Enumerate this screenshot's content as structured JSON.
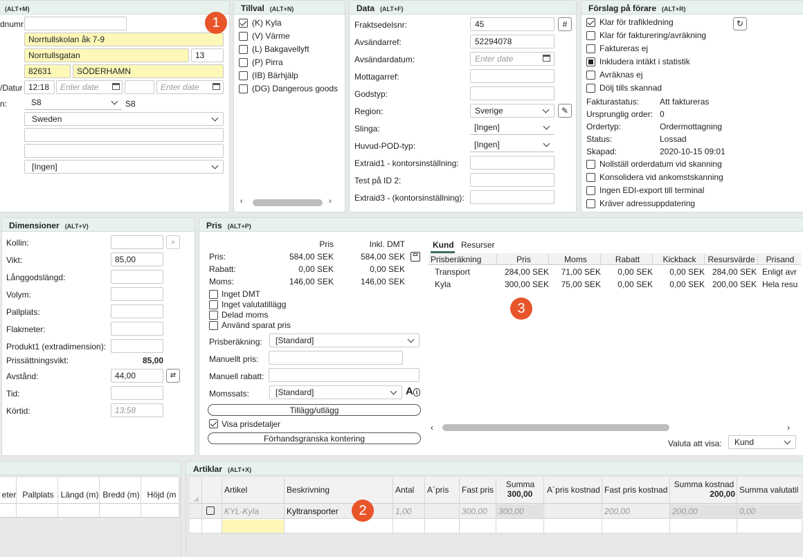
{
  "panel_a": {
    "header": "(ALT+M)",
    "labels": {
      "dnumr": "dnumr",
      "datur": "/Datur",
      "n": "n:"
    },
    "name": "Norrtullskolan åk 7-9",
    "street": "Norrtullsgatan",
    "street_no": "13",
    "zip": "82631",
    "city": "SÖDERHAMN",
    "time": "12:18",
    "date1": "Enter date",
    "date2": "Enter date",
    "code": "S8",
    "code_text": "S8",
    "country": "Sweden",
    "select_last": "[Ingen]"
  },
  "tillval": {
    "title": "Tillval",
    "shortcut": "(ALT+N)",
    "items": [
      {
        "label": "(K) Kyla",
        "checked": true
      },
      {
        "label": "(V) Värme",
        "checked": false
      },
      {
        "label": "(L) Bakgavellyft",
        "checked": false
      },
      {
        "label": "(P) Pirra",
        "checked": false
      },
      {
        "label": "(IB) Bärhjälp",
        "checked": false
      },
      {
        "label": "(DG) Dangerous goods",
        "checked": false
      }
    ]
  },
  "data_panel": {
    "title": "Data",
    "shortcut": "(ALT+F)",
    "rows": [
      {
        "label": "Fraktsedelsnr:",
        "value": "45"
      },
      {
        "label": "Avsändarref:",
        "value": "52294078"
      },
      {
        "label": "Avsändardatum:",
        "value": "Enter date"
      },
      {
        "label": "Mottagarref:",
        "value": ""
      },
      {
        "label": "Godstyp:",
        "value": ""
      },
      {
        "label": "Region:",
        "value": "Sverige"
      },
      {
        "label": "Slinga:",
        "value": "[Ingen]"
      },
      {
        "label": "Huvud-POD-typ:",
        "value": "[Ingen]"
      },
      {
        "label": "Extraid1 - kontorsinställning:",
        "value": ""
      },
      {
        "label": "Test på ID 2:",
        "value": ""
      },
      {
        "label": "Extraid3 - (kontorsinställning):",
        "value": ""
      }
    ],
    "hash": "#"
  },
  "forslag": {
    "title": "Förslag på förare",
    "shortcut": "(ALT+R)",
    "checks": [
      {
        "label": "Klar för trafikledning",
        "state": "on"
      },
      {
        "label": "Klar för fakturering/avräkning",
        "state": "off"
      },
      {
        "label": "Faktureras ej",
        "state": "off"
      },
      {
        "label": "Inkludera intäkt i statistik",
        "state": "fill"
      },
      {
        "label": "Avräknas ej",
        "state": "off"
      },
      {
        "label": "Dölj tills skannad",
        "state": "off"
      }
    ],
    "info": [
      {
        "k": "Fakturastatus:",
        "v": "Att faktureras"
      },
      {
        "k": "Ursprunglig order:",
        "v": "0"
      },
      {
        "k": "Ordertyp:",
        "v": "Ordermottagning"
      },
      {
        "k": "Status:",
        "v": "Lossad"
      },
      {
        "k": "Skapad:",
        "v": "2020-10-15 09:01"
      }
    ],
    "checks2": [
      "Nollställ orderdatum vid skanning",
      "Konsolidera vid ankomstskanning",
      "Ingen EDI-export till terminal",
      "Kräver adressuppdatering"
    ]
  },
  "dim": {
    "title": "Dimensioner",
    "shortcut": "(ALT+V)",
    "rows": [
      {
        "label": "Kollin:",
        "value": ""
      },
      {
        "label": "Vikt:",
        "value": "85,00"
      },
      {
        "label": "Långgodslängd:",
        "value": ""
      },
      {
        "label": "Volym:",
        "value": ""
      },
      {
        "label": "Pallplats:",
        "value": ""
      },
      {
        "label": "Flakmeter:",
        "value": ""
      },
      {
        "label": "Produkt1 (extradimension):",
        "value": ""
      }
    ],
    "prisvikt_label": "Prissättningsvikt:",
    "prisvikt": "85,00",
    "avstand_label": "Avstånd:",
    "avstand": "44,00",
    "tid_label": "Tid:",
    "kortid_label": "Körtid:",
    "kortid": "13:58"
  },
  "pris": {
    "title": "Pris",
    "shortcut": "(ALT+P)",
    "col1": "Pris",
    "col2": "Inkl. DMT",
    "rows": [
      {
        "k": "Pris:",
        "a": "584,00 SEK",
        "b": "584,00 SEK"
      },
      {
        "k": "Rabatt:",
        "a": "0,00 SEK",
        "b": "0,00 SEK"
      },
      {
        "k": "Moms:",
        "a": "146,00 SEK",
        "b": "146,00 SEK"
      }
    ],
    "checks": [
      "Inget DMT",
      "Inget valutatillägg",
      "Delad moms",
      "Använd sparat pris"
    ],
    "prisberakning_label": "Prisberäkning:",
    "prisberakning": "[Standard]",
    "manuellt_label": "Manuellt pris:",
    "rabatt_label": "Manuell rabatt:",
    "moms_label": "Momssats:",
    "moms": "[Standard]",
    "tillagg": "Tillägg/utlägg",
    "visa": "Visa prisdetaljer",
    "forhand": "Förhandsgranska kontering",
    "tab1": "Kund",
    "tab2": "Resurser",
    "grid_headers": [
      "Prisberäkning",
      "Pris",
      "Moms",
      "Rabatt",
      "Kickback",
      "Resursvärde",
      "Prisand"
    ],
    "grid_rows": [
      [
        "Transport",
        "284,00 SEK",
        "71,00 SEK",
        "0,00 SEK",
        "0,00 SEK",
        "284,00 SEK",
        "Enligt avr"
      ],
      [
        "Kyla",
        "300,00 SEK",
        "75,00 SEK",
        "0,00 SEK",
        "0,00 SEK",
        "200,00 SEK",
        "Hela resu"
      ]
    ],
    "valuta_label": "Valuta att visa:",
    "valuta": "Kund"
  },
  "left_grid": {
    "headers": [
      "eter",
      "Pallplats",
      "Längd (m)",
      "Bredd (m)",
      "Höjd (m"
    ]
  },
  "artiklar": {
    "title": "Artiklar",
    "shortcut": "(ALT+X)",
    "headers": [
      "Artikel",
      "Beskrivning",
      "Antal",
      "A´pris",
      "Fast pris",
      "Summa",
      "A´pris kostnad",
      "Fast pris kostnad",
      "Summa kostnad",
      "Summa valutatil"
    ],
    "summa_total": "300,00",
    "kostnad_total": "200,00",
    "row": [
      "KYL-Kyla",
      "Kyltransporter",
      "1,00",
      "",
      "300,00",
      "300,00",
      "",
      "200,00",
      "200,00",
      "0,00"
    ]
  },
  "markers": [
    "1",
    "2",
    "3"
  ]
}
